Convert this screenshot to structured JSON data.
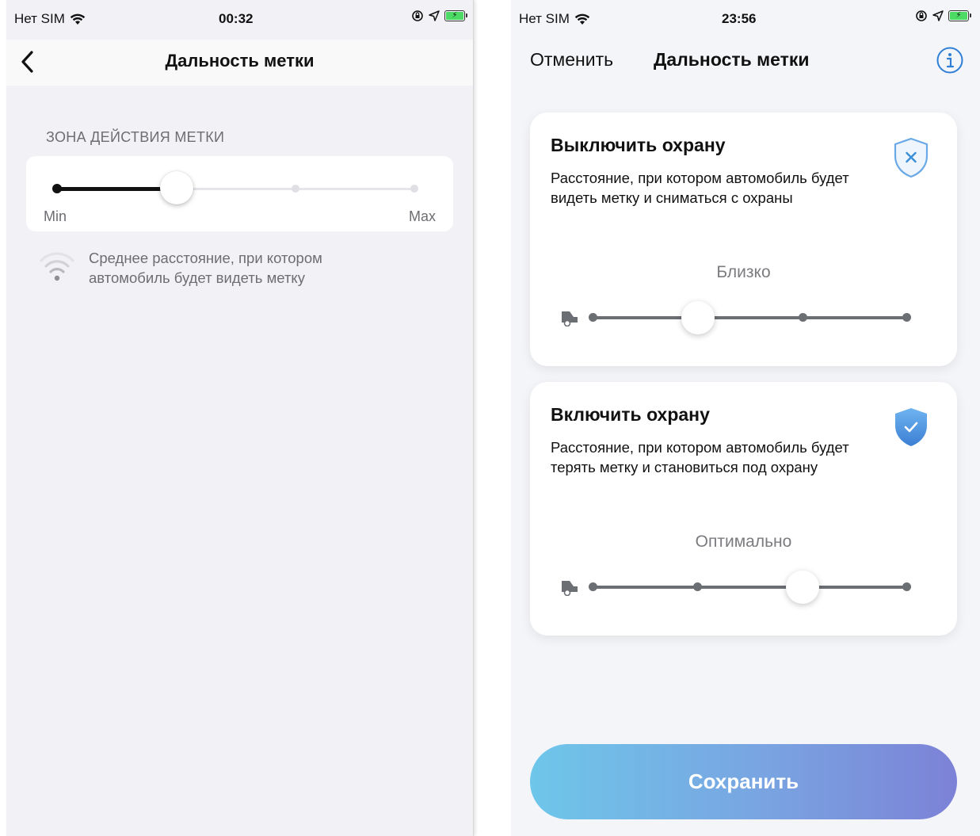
{
  "left": {
    "status": {
      "carrier": "Нет SIM",
      "time": "00:32"
    },
    "nav": {
      "title": "Дальность метки"
    },
    "section_caption": "ЗОНА ДЕЙСТВИЯ МЕТКИ",
    "slider": {
      "min_label": "Min",
      "max_label": "Max",
      "value": 0.33
    },
    "hint": "Среднее расстояние, при котором автомобиль будет видеть метку"
  },
  "right": {
    "status": {
      "carrier": "Нет SIM",
      "time": "23:56"
    },
    "nav": {
      "cancel_label": "Отменить",
      "title": "Дальность метки"
    },
    "cards": [
      {
        "title": "Выключить охрану",
        "description": "Расстояние, при котором автомобиль будет видеть метку и сниматься с охраны",
        "level_label": "Близко",
        "icon": "shield-off-icon",
        "slider_value": 0.33
      },
      {
        "title": "Включить охрану",
        "description": "Расстояние, при котором автомобиль будет терять метку и становиться под охрану",
        "level_label": "Оптимально",
        "icon": "shield-check-icon",
        "slider_value": 0.67
      }
    ],
    "save_label": "Сохранить"
  },
  "colors": {
    "accent": "#3a8fd8",
    "slider_track": "#6b6e73",
    "button_gradient_start": "#6ec6ea",
    "button_gradient_end": "#7c82d7"
  }
}
